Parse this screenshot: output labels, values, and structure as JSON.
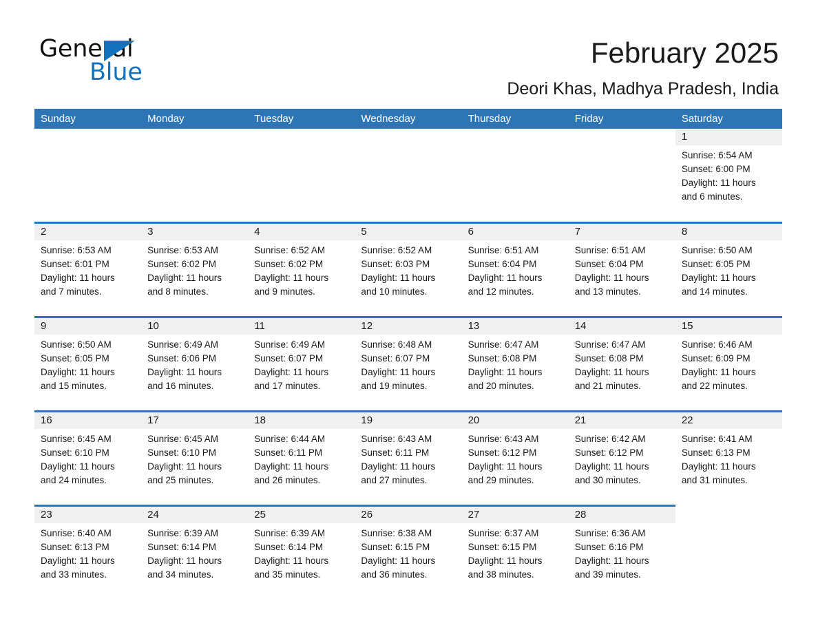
{
  "brand": {
    "name_part1": "General",
    "name_part2": "Blue"
  },
  "header": {
    "title": "February 2025",
    "subtitle": "Deori Khas, Madhya Pradesh, India"
  },
  "colors": {
    "header_blue": "#2e75b6",
    "logo_blue": "#1272bb",
    "daynum_band": "#f0f0f0",
    "text": "#1a1a1a"
  },
  "weekdays": [
    "Sunday",
    "Monday",
    "Tuesday",
    "Wednesday",
    "Thursday",
    "Friday",
    "Saturday"
  ],
  "weeks": [
    [
      {
        "blank": true
      },
      {
        "blank": true
      },
      {
        "blank": true
      },
      {
        "blank": true
      },
      {
        "blank": true
      },
      {
        "blank": true
      },
      {
        "day": "1",
        "sunrise": "Sunrise: 6:54 AM",
        "sunset": "Sunset: 6:00 PM",
        "daylight1": "Daylight: 11 hours",
        "daylight2": "and 6 minutes."
      }
    ],
    [
      {
        "day": "2",
        "sunrise": "Sunrise: 6:53 AM",
        "sunset": "Sunset: 6:01 PM",
        "daylight1": "Daylight: 11 hours",
        "daylight2": "and 7 minutes."
      },
      {
        "day": "3",
        "sunrise": "Sunrise: 6:53 AM",
        "sunset": "Sunset: 6:02 PM",
        "daylight1": "Daylight: 11 hours",
        "daylight2": "and 8 minutes."
      },
      {
        "day": "4",
        "sunrise": "Sunrise: 6:52 AM",
        "sunset": "Sunset: 6:02 PM",
        "daylight1": "Daylight: 11 hours",
        "daylight2": "and 9 minutes."
      },
      {
        "day": "5",
        "sunrise": "Sunrise: 6:52 AM",
        "sunset": "Sunset: 6:03 PM",
        "daylight1": "Daylight: 11 hours",
        "daylight2": "and 10 minutes."
      },
      {
        "day": "6",
        "sunrise": "Sunrise: 6:51 AM",
        "sunset": "Sunset: 6:04 PM",
        "daylight1": "Daylight: 11 hours",
        "daylight2": "and 12 minutes."
      },
      {
        "day": "7",
        "sunrise": "Sunrise: 6:51 AM",
        "sunset": "Sunset: 6:04 PM",
        "daylight1": "Daylight: 11 hours",
        "daylight2": "and 13 minutes."
      },
      {
        "day": "8",
        "sunrise": "Sunrise: 6:50 AM",
        "sunset": "Sunset: 6:05 PM",
        "daylight1": "Daylight: 11 hours",
        "daylight2": "and 14 minutes."
      }
    ],
    [
      {
        "day": "9",
        "sunrise": "Sunrise: 6:50 AM",
        "sunset": "Sunset: 6:05 PM",
        "daylight1": "Daylight: 11 hours",
        "daylight2": "and 15 minutes."
      },
      {
        "day": "10",
        "sunrise": "Sunrise: 6:49 AM",
        "sunset": "Sunset: 6:06 PM",
        "daylight1": "Daylight: 11 hours",
        "daylight2": "and 16 minutes."
      },
      {
        "day": "11",
        "sunrise": "Sunrise: 6:49 AM",
        "sunset": "Sunset: 6:07 PM",
        "daylight1": "Daylight: 11 hours",
        "daylight2": "and 17 minutes."
      },
      {
        "day": "12",
        "sunrise": "Sunrise: 6:48 AM",
        "sunset": "Sunset: 6:07 PM",
        "daylight1": "Daylight: 11 hours",
        "daylight2": "and 19 minutes."
      },
      {
        "day": "13",
        "sunrise": "Sunrise: 6:47 AM",
        "sunset": "Sunset: 6:08 PM",
        "daylight1": "Daylight: 11 hours",
        "daylight2": "and 20 minutes."
      },
      {
        "day": "14",
        "sunrise": "Sunrise: 6:47 AM",
        "sunset": "Sunset: 6:08 PM",
        "daylight1": "Daylight: 11 hours",
        "daylight2": "and 21 minutes."
      },
      {
        "day": "15",
        "sunrise": "Sunrise: 6:46 AM",
        "sunset": "Sunset: 6:09 PM",
        "daylight1": "Daylight: 11 hours",
        "daylight2": "and 22 minutes."
      }
    ],
    [
      {
        "day": "16",
        "sunrise": "Sunrise: 6:45 AM",
        "sunset": "Sunset: 6:10 PM",
        "daylight1": "Daylight: 11 hours",
        "daylight2": "and 24 minutes."
      },
      {
        "day": "17",
        "sunrise": "Sunrise: 6:45 AM",
        "sunset": "Sunset: 6:10 PM",
        "daylight1": "Daylight: 11 hours",
        "daylight2": "and 25 minutes."
      },
      {
        "day": "18",
        "sunrise": "Sunrise: 6:44 AM",
        "sunset": "Sunset: 6:11 PM",
        "daylight1": "Daylight: 11 hours",
        "daylight2": "and 26 minutes."
      },
      {
        "day": "19",
        "sunrise": "Sunrise: 6:43 AM",
        "sunset": "Sunset: 6:11 PM",
        "daylight1": "Daylight: 11 hours",
        "daylight2": "and 27 minutes."
      },
      {
        "day": "20",
        "sunrise": "Sunrise: 6:43 AM",
        "sunset": "Sunset: 6:12 PM",
        "daylight1": "Daylight: 11 hours",
        "daylight2": "and 29 minutes."
      },
      {
        "day": "21",
        "sunrise": "Sunrise: 6:42 AM",
        "sunset": "Sunset: 6:12 PM",
        "daylight1": "Daylight: 11 hours",
        "daylight2": "and 30 minutes."
      },
      {
        "day": "22",
        "sunrise": "Sunrise: 6:41 AM",
        "sunset": "Sunset: 6:13 PM",
        "daylight1": "Daylight: 11 hours",
        "daylight2": "and 31 minutes."
      }
    ],
    [
      {
        "day": "23",
        "sunrise": "Sunrise: 6:40 AM",
        "sunset": "Sunset: 6:13 PM",
        "daylight1": "Daylight: 11 hours",
        "daylight2": "and 33 minutes."
      },
      {
        "day": "24",
        "sunrise": "Sunrise: 6:39 AM",
        "sunset": "Sunset: 6:14 PM",
        "daylight1": "Daylight: 11 hours",
        "daylight2": "and 34 minutes."
      },
      {
        "day": "25",
        "sunrise": "Sunrise: 6:39 AM",
        "sunset": "Sunset: 6:14 PM",
        "daylight1": "Daylight: 11 hours",
        "daylight2": "and 35 minutes."
      },
      {
        "day": "26",
        "sunrise": "Sunrise: 6:38 AM",
        "sunset": "Sunset: 6:15 PM",
        "daylight1": "Daylight: 11 hours",
        "daylight2": "and 36 minutes."
      },
      {
        "day": "27",
        "sunrise": "Sunrise: 6:37 AM",
        "sunset": "Sunset: 6:15 PM",
        "daylight1": "Daylight: 11 hours",
        "daylight2": "and 38 minutes."
      },
      {
        "day": "28",
        "sunrise": "Sunrise: 6:36 AM",
        "sunset": "Sunset: 6:16 PM",
        "daylight1": "Daylight: 11 hours",
        "daylight2": "and 39 minutes."
      },
      {
        "blank": true
      }
    ]
  ]
}
